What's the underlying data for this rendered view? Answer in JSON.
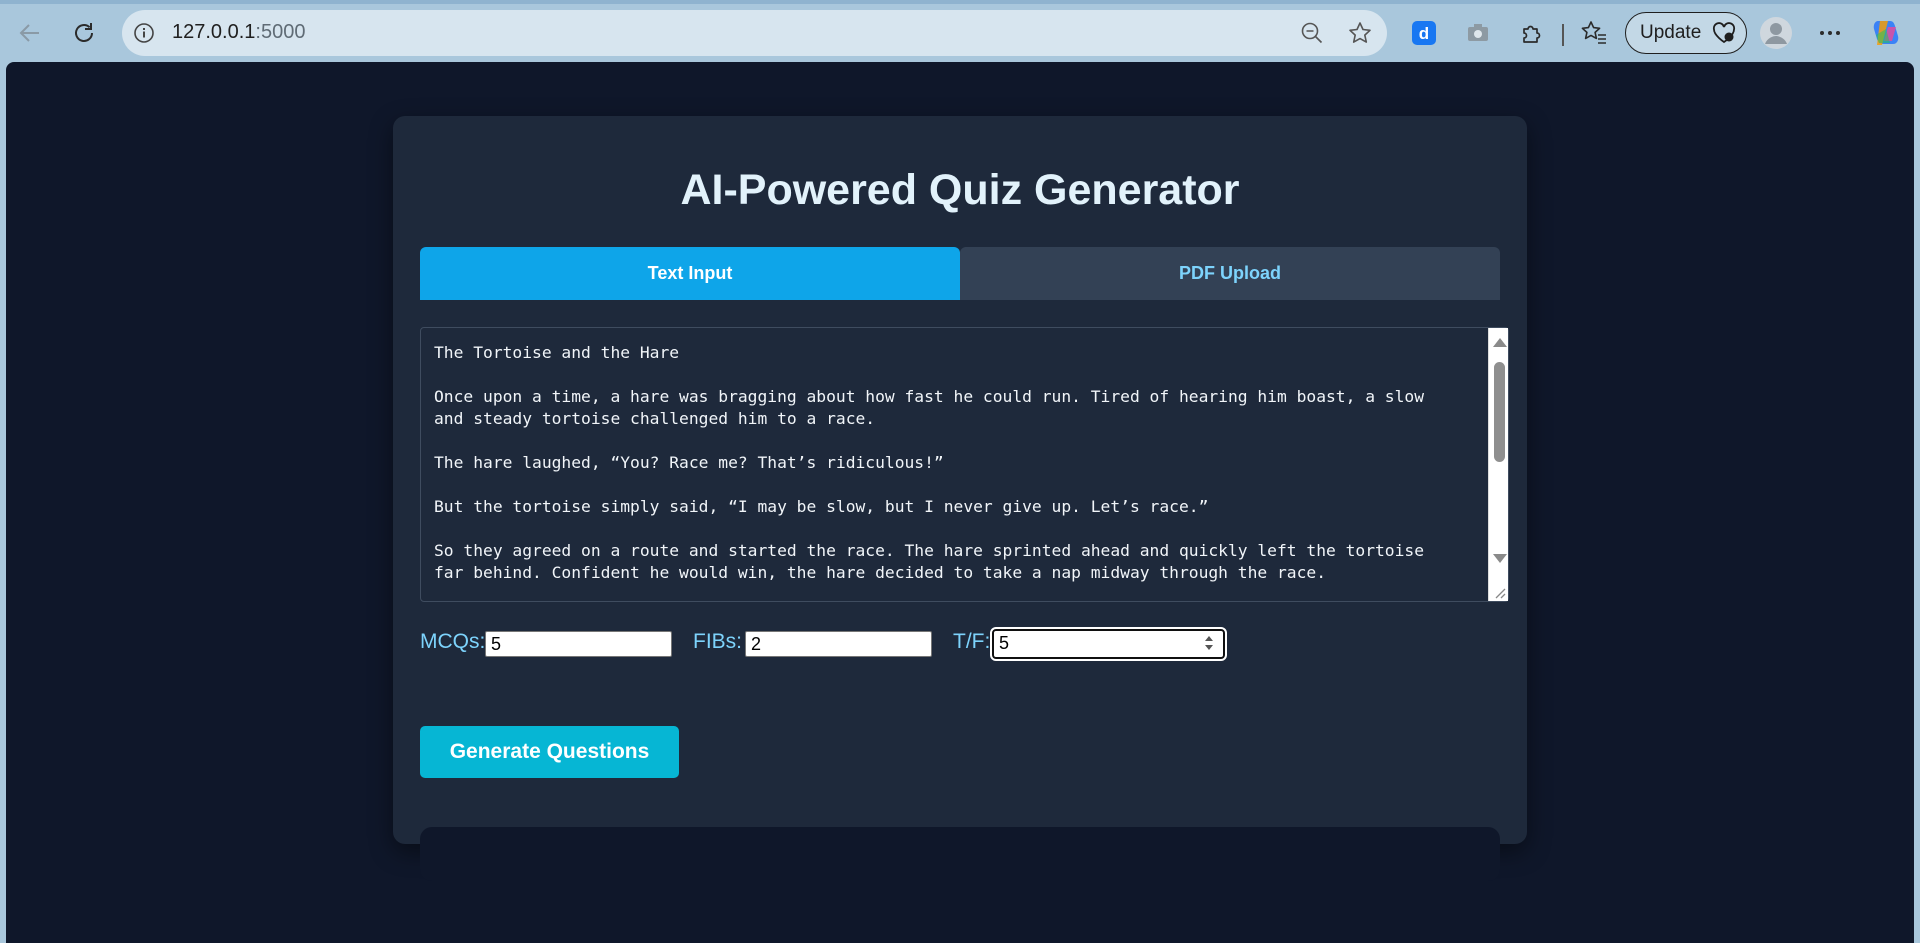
{
  "browser": {
    "url_host": "127.0.0.1",
    "url_port": ":5000",
    "update_label": "Update"
  },
  "page": {
    "title": "AI-Powered Quiz Generator",
    "tabs": [
      {
        "label": "Text Input",
        "active": true
      },
      {
        "label": "PDF Upload",
        "active": false
      }
    ],
    "text_content": "The Tortoise and the Hare\n\nOnce upon a time, a hare was bragging about how fast he could run. Tired of hearing him boast, a slow\nand steady tortoise challenged him to a race.\n\nThe hare laughed, “You? Race me? That’s ridiculous!”\n\nBut the tortoise simply said, “I may be slow, but I never give up. Let’s race.”\n\nSo they agreed on a route and started the race. The hare sprinted ahead and quickly left the tortoise\nfar behind. Confident he would win, the hare decided to take a nap midway through the race.",
    "counts": {
      "mcq_label": "MCQs:",
      "mcq_value": "5",
      "fib_label": "FIBs:",
      "fib_value": "2",
      "tf_label": "T/F:",
      "tf_value": "5"
    },
    "generate_label": "Generate Questions"
  },
  "colors": {
    "background": "#0f172a",
    "card": "#1e293b",
    "active_tab": "#0ea5e9",
    "inactive_tab": "#334155",
    "accent_text": "#7dd3fc",
    "button": "#06b6d4"
  }
}
